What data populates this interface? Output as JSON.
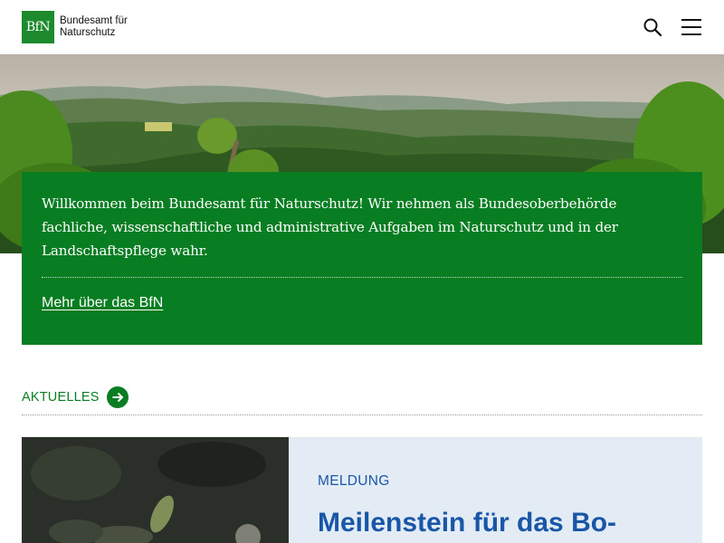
{
  "header": {
    "logo_mark": "BfN",
    "logo_text": "Bundesamt für Naturschutz",
    "search_icon": "search-icon",
    "menu_icon": "hamburger-menu-icon"
  },
  "hero": {
    "image": "forest-hills-landscape"
  },
  "intro": {
    "text": "Willkommen beim Bundesamt für Naturschutz! Wir nehmen als Bundesoberbehörde fachliche, wissenschaftliche und administrative Aufgaben im Naturschutz und in der Landschaftspflege wahr.",
    "link": "Mehr über das BfN"
  },
  "news": {
    "heading": "AKTUELLES",
    "arrow_icon": "arrow-right-circle-icon",
    "card": {
      "type": "MELDUNG",
      "title": "Meilenstein für das Bo-"
    }
  },
  "colors": {
    "brand_green": "#087d22",
    "logo_green": "#1e8a2e",
    "link_blue": "#1a56a8",
    "card_bg": "#e3ecf4"
  }
}
